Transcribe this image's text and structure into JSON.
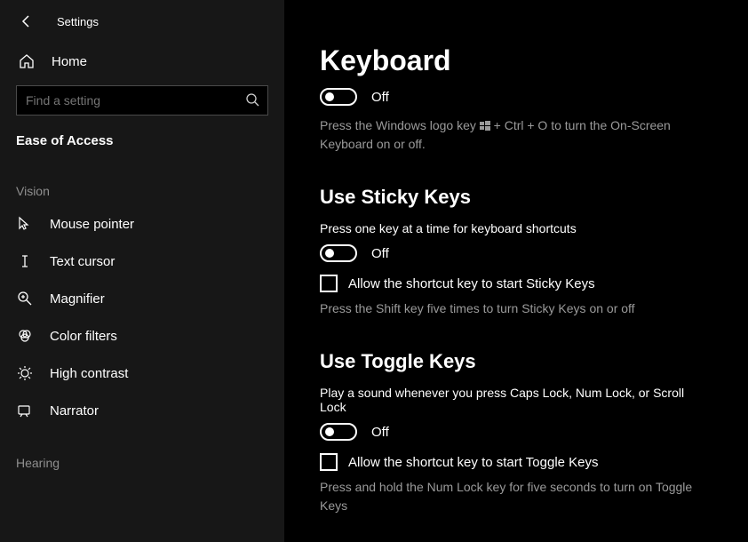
{
  "window": {
    "title": "Settings"
  },
  "sidebar": {
    "home": "Home",
    "search_placeholder": "Find a setting",
    "breadcrumb": "Ease of Access",
    "section_vision": "Vision",
    "items": [
      {
        "label": "Mouse pointer"
      },
      {
        "label": "Text cursor"
      },
      {
        "label": "Magnifier"
      },
      {
        "label": "Color filters"
      },
      {
        "label": "High contrast"
      },
      {
        "label": "Narrator"
      }
    ],
    "section_hearing": "Hearing"
  },
  "page": {
    "title": "Keyboard",
    "onscreen": {
      "toggle_state": "Off",
      "hint_before": "Press the Windows logo key ",
      "hint_after": " + Ctrl + O to turn the On-Screen Keyboard on or off."
    },
    "sticky": {
      "heading": "Use Sticky Keys",
      "desc": "Press one key at a time for keyboard shortcuts",
      "toggle_state": "Off",
      "check_label": "Allow the shortcut key to start Sticky Keys",
      "hint": "Press the Shift key five times to turn Sticky Keys on or off"
    },
    "toggle_keys": {
      "heading": "Use Toggle Keys",
      "desc": "Play a sound whenever you press Caps Lock, Num Lock, or Scroll Lock",
      "toggle_state": "Off",
      "check_label": "Allow the shortcut key to start Toggle Keys",
      "hint": "Press and hold the Num Lock key for five seconds to turn on Toggle Keys"
    }
  }
}
